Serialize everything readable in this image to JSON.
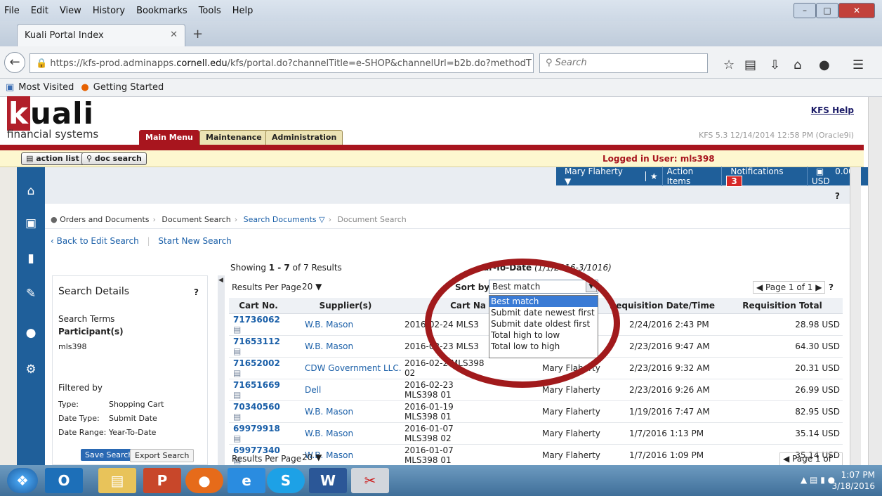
{
  "firefox": {
    "menu": [
      "File",
      "Edit",
      "View",
      "History",
      "Bookmarks",
      "Tools",
      "Help"
    ],
    "tab_title": "Kuali Portal Index",
    "url_prefix": "https://kfs-prod.adminapps.",
    "url_domain": "cornell.edu",
    "url_suffix": "/kfs/portal.do?channelTitle=e-SHOP&channelUrl=b2b.do?methodT",
    "search_placeholder": "Search",
    "bookmarks": [
      "Most Visited",
      "Getting Started"
    ]
  },
  "kuali": {
    "logo": "uali",
    "logo_k": "k",
    "logo_sub": "financial systems",
    "tabs": [
      "Main Menu",
      "Maintenance",
      "Administration"
    ],
    "help": "KFS Help",
    "version": "KFS 5.3 12/14/2014 12:58 PM (Oracle9i)",
    "action_list": "action list",
    "doc_search": "doc search",
    "logged_in": "Logged in User: mls398"
  },
  "topbar": {
    "user": "Mary Flaherty",
    "action_items": "Action Items",
    "notifications": "Notifications",
    "notif_count": "3",
    "cart": "0.00 USD",
    "help_q": "?"
  },
  "breadcrumb": [
    "Orders and Documents",
    "Document Search",
    "Search Documents",
    "Document Search"
  ],
  "links": {
    "back": "Back to Edit Search",
    "new": "Start New Search"
  },
  "search_details": {
    "title": "Search Details",
    "q": "?",
    "terms_label": "Search Terms",
    "participant_label": "Participant(s)",
    "participant": "mls398",
    "filtered_label": "Filtered by",
    "type_label": "Type:",
    "type_value": "Shopping Cart",
    "date_type_label": "Date Type:",
    "date_type_value": "Submit Date",
    "date_range": "Date Range: Year-To-Date",
    "save": "Save Search",
    "export": "Export Search"
  },
  "results": {
    "showing": "Showing ",
    "range": "1 - 7",
    "of": " of 7 Results",
    "period": "ear-To-Date",
    "period_range": "(1/1/2016-3/1",
    "period_end": "016)",
    "per_page_label": "Results Per Page",
    "per_page": "20",
    "sort_label": "Sort by:",
    "sort_value": "Best match",
    "page_label": "Page 1 of 1",
    "q": "?",
    "columns": [
      "Cart No.",
      "Supplier(s)",
      "Cart Na",
      "er",
      "Requisition Date/Time",
      "Requisition Total"
    ],
    "rows": [
      {
        "cart": "71736062",
        "supplier": "W.B. Mason",
        "name": "2016-02-24 MLS3",
        "pre": "",
        "date": "2/24/2016 2:43 PM",
        "total": "28.98 USD"
      },
      {
        "cart": "71653112",
        "supplier": "W.B. Mason",
        "name": "2016-02-23 MLS3",
        "pre": "",
        "date": "2/23/2016 9:47 AM",
        "total": "64.30 USD"
      },
      {
        "cart": "71652002",
        "supplier": "CDW Government LLC.",
        "name": "2016-02-2 MLS398 02",
        "pre": "Mary Flaherty",
        "date": "2/23/2016 9:32 AM",
        "total": "20.31 USD"
      },
      {
        "cart": "71651669",
        "supplier": "Dell",
        "name": "2016-02-23 MLS398 01",
        "pre": "Mary Flaherty",
        "date": "2/23/2016 9:26 AM",
        "total": "26.99 USD"
      },
      {
        "cart": "70340560",
        "supplier": "W.B. Mason",
        "name": "2016-01-19 MLS398 01",
        "pre": "Mary Flaherty",
        "date": "1/19/2016 7:47 AM",
        "total": "82.95 USD"
      },
      {
        "cart": "69979918",
        "supplier": "W.B. Mason",
        "name": "2016-01-07 MLS398 02",
        "pre": "Mary Flaherty",
        "date": "1/7/2016 1:13 PM",
        "total": "35.14 USD"
      },
      {
        "cart": "69977340",
        "supplier": "W.B. Mason",
        "name": "2016-01-07 MLS398 01",
        "pre": "Mary Flaherty",
        "date": "1/7/2016 1:09 PM",
        "total": "35.14 USD"
      }
    ],
    "sort_options": [
      "Best match",
      "Submit date newest first",
      "Submit date oldest first",
      "Total high to low",
      "Total low to high"
    ],
    "bottom_page": "Page 1 of 1"
  },
  "taskbar": {
    "time": "1:07 PM",
    "date": "3/18/2016"
  },
  "colors": {
    "kuali_red": "#a8151e",
    "nav_blue": "#1f5f9a",
    "link": "#1a5fa8",
    "highlight_circle": "#a11a1c"
  }
}
